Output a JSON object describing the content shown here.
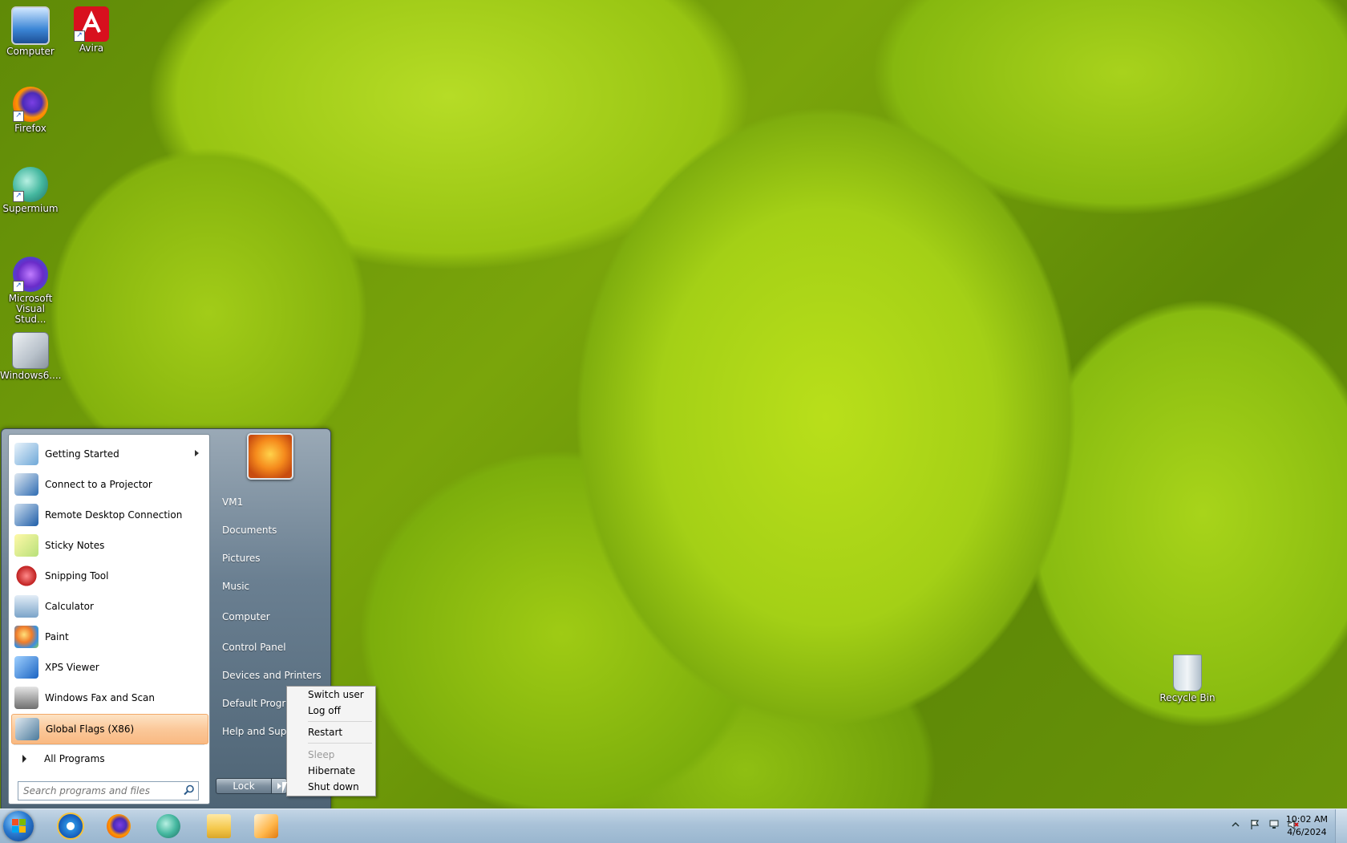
{
  "desktop": {
    "icons": [
      {
        "label": "Computer"
      },
      {
        "label": "Avira"
      },
      {
        "label": "Firefox"
      },
      {
        "label": "Supermium"
      },
      {
        "label": "Microsoft Visual Stud..."
      },
      {
        "label": "Windows6...."
      },
      {
        "label": "Recycle Bin"
      }
    ]
  },
  "start_menu": {
    "programs": [
      {
        "label": "Getting Started"
      },
      {
        "label": "Connect to a Projector"
      },
      {
        "label": "Remote Desktop Connection"
      },
      {
        "label": "Sticky Notes"
      },
      {
        "label": "Snipping Tool"
      },
      {
        "label": "Calculator"
      },
      {
        "label": "Paint"
      },
      {
        "label": "XPS Viewer"
      },
      {
        "label": "Windows Fax and Scan"
      },
      {
        "label": "Global Flags (X86)"
      }
    ],
    "all_programs": "All Programs",
    "search_placeholder": "Search programs and files",
    "right_links": [
      {
        "label": "VM1"
      },
      {
        "label": "Documents"
      },
      {
        "label": "Pictures"
      },
      {
        "label": "Music"
      },
      {
        "label": "Computer"
      },
      {
        "label": "Control Panel"
      },
      {
        "label": "Devices and Printers"
      },
      {
        "label": "Default Programs"
      },
      {
        "label": "Help and Support"
      }
    ],
    "lock_button": "Lock"
  },
  "power_menu": {
    "items": [
      {
        "label": "Switch user",
        "enabled": true
      },
      {
        "label": "Log off",
        "enabled": true
      },
      {
        "label": "Restart",
        "enabled": true
      },
      {
        "label": "Sleep",
        "enabled": false
      },
      {
        "label": "Hibernate",
        "enabled": true
      },
      {
        "label": "Shut down",
        "enabled": true
      }
    ]
  },
  "taskbar": {
    "pinned": [
      "internet-explorer-icon",
      "firefox-icon",
      "supermium-icon",
      "file-explorer-icon",
      "media-player-icon"
    ],
    "clock": {
      "time": "10:02 AM",
      "date": "4/6/2024"
    }
  },
  "colors": {
    "highlight": "#fbc89a",
    "taskbar": "#a9c2d8",
    "wallpaper": "#a4d016"
  }
}
